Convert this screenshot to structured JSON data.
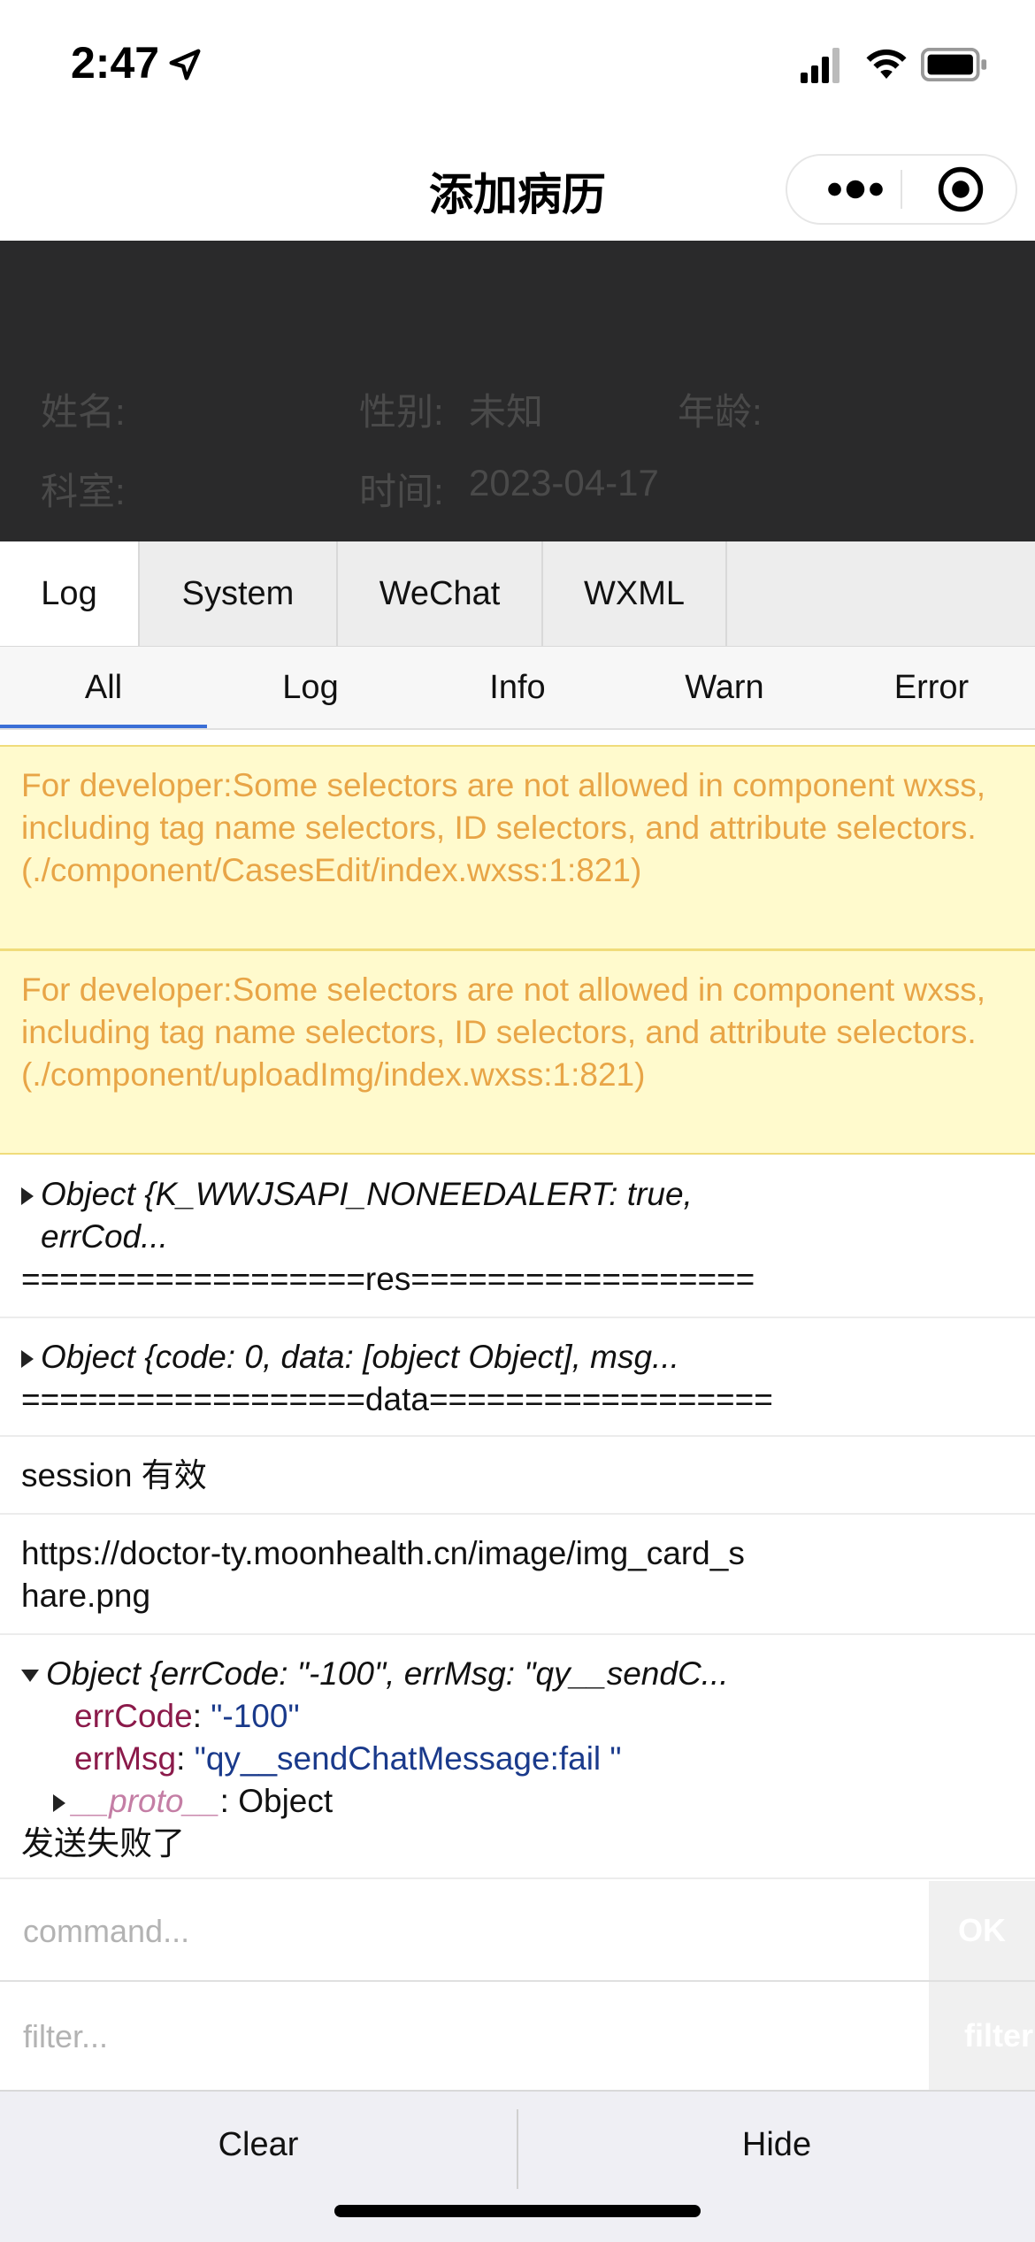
{
  "status": {
    "time": "2:47"
  },
  "nav": {
    "title": "添加病历"
  },
  "form": {
    "name_label": "姓名:",
    "gender_label": "性别:",
    "gender_value": "未知",
    "age_label": "年龄:",
    "dept_label": "科室:",
    "time_label": "时间:",
    "time_value": "2023-04-17"
  },
  "tabs": [
    "Log",
    "System",
    "WeChat",
    "WXML"
  ],
  "subtabs": [
    "All",
    "Log",
    "Info",
    "Warn",
    "Error"
  ],
  "logs": {
    "warn1": "For developer:Some selectors are not allowed in component wxss, including tag name selectors, ID selectors, and attribute selectors.(./component/CasesEdit/index.wxss:1:821)",
    "warn2": "For developer:Some selectors are not allowed in component wxss, including tag name selectors, ID selectors, and attribute selectors.(./component/uploadImg/index.wxss:1:821)",
    "obj1": "Object {K_WWJSAPI_NONEEDALERT: true, errCod...",
    "res_line": "==================res==================",
    "obj2": "Object {code: 0, data: [object Object], msg...",
    "data_line": "==================data==================",
    "session": "session 有效",
    "url": "https://doctor-ty.moonhealth.cn/image/img_card_share.png",
    "obj3": "Object {errCode: \"-100\", errMsg: \"qy__sendC...",
    "errcode_key": "errCode",
    "errcode_val": "\"-100\"",
    "errmsg_key": "errMsg",
    "errmsg_val": "\"qy__sendChatMessage:fail \"",
    "proto_key": "__proto__",
    "proto_val": ": Object",
    "fail": "发送失败了"
  },
  "command": {
    "placeholder": "command...",
    "button": "OK"
  },
  "filter": {
    "placeholder": "filter...",
    "button": "filter"
  },
  "bottom": {
    "clear": "Clear",
    "hide": "Hide"
  },
  "colors": {
    "warn_bg": "#fffacd",
    "warn_text": "#e8a547",
    "overlay": "#2a2a2b",
    "accent": "#3b6fd6"
  }
}
